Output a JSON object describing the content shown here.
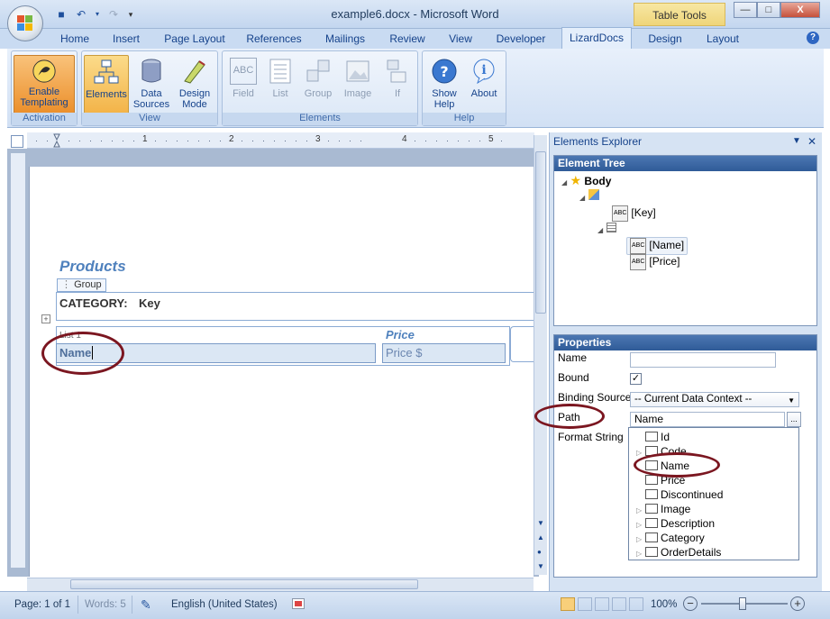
{
  "window": {
    "title": "example6.docx - Microsoft Word",
    "context_tab": "Table Tools",
    "controls": {
      "minimize": "—",
      "maximize": "□",
      "close": "X"
    }
  },
  "ribbon_tabs": [
    "Home",
    "Insert",
    "Page Layout",
    "References",
    "Mailings",
    "Review",
    "View",
    "Developer",
    "LizardDocs",
    "Design",
    "Layout"
  ],
  "active_tab": "LizardDocs",
  "ribbon": {
    "groups": [
      {
        "label": "Activation",
        "buttons": [
          "Enable Templating"
        ]
      },
      {
        "label": "View",
        "buttons": [
          "Elements",
          "Data Sources",
          "Design Mode"
        ]
      },
      {
        "label": "Elements",
        "buttons": [
          "Field",
          "List",
          "Group",
          "Image",
          "If"
        ]
      },
      {
        "label": "Help",
        "buttons": [
          "Show Help",
          "About"
        ]
      }
    ],
    "btn": {
      "enable1": "Enable",
      "enable2": "Templating",
      "elements": "Elements",
      "data1": "Data",
      "data2": "Sources",
      "design1": "Design",
      "design2": "Mode",
      "field": "Field",
      "list": "List",
      "group": "Group",
      "image": "Image",
      "if": "If",
      "show1": "Show",
      "show2": "Help",
      "about": "About",
      "field_icon_text": "ABC"
    }
  },
  "ruler": {
    "numbers": [
      "1",
      "2",
      "3",
      "4",
      "5"
    ]
  },
  "document": {
    "heading": "Products",
    "group_tag": "Group",
    "category_label": "CATEGORY:",
    "category_value": "Key",
    "list_tag": "List 1",
    "col_price": "Price",
    "name_field": "Name",
    "price_field": "Price $"
  },
  "status": {
    "page": "Page: 1 of 1",
    "words": "Words: 5",
    "language": "English (United States)",
    "zoom": "100%"
  },
  "panel": {
    "title": "Elements Explorer",
    "tree_header": "Element Tree",
    "tree": {
      "body": "Body",
      "key": "[Key]",
      "name": "[Name]",
      "price": "[Price]"
    },
    "props_header": "Properties",
    "props": {
      "name_label": "Name",
      "name_value": "",
      "bound_label": "Bound",
      "bound_checked": true,
      "binding_label": "Binding Source",
      "binding_value": "-- Current Data Context --",
      "path_label": "Path",
      "path_value": "Name",
      "format_label": "Format String"
    },
    "path_options": [
      "Id",
      "Code",
      "Name",
      "Price",
      "Discontinued",
      "Image",
      "Description",
      "Category",
      "OrderDetails"
    ]
  },
  "colors": {
    "annotation_oval": "#7b1620",
    "heading": "#4f81bd",
    "ribbon_active": "#f3b348"
  }
}
